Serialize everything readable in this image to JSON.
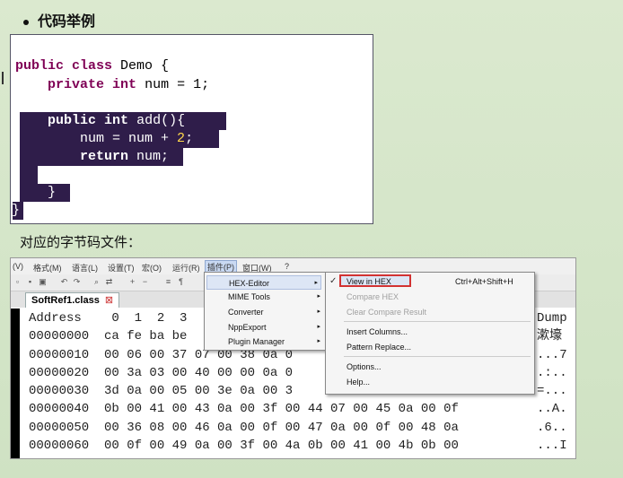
{
  "slide": {
    "bullet": "代码举例",
    "caption": "对应的字节码文件："
  },
  "code": {
    "l1_kw1": "public",
    "l1_kw2": "class",
    "l1_rest": " Demo {",
    "l2_kw1": "private",
    "l2_kw2": "int",
    "l2_rest": " num = ",
    "l2_num": "1",
    "l2_end": ";",
    "l3_kw1": "public",
    "l3_kw2": "int",
    "l3_rest": " add(){",
    "l4_rest": "num = num + ",
    "l4_num": "2",
    "l4_end": ";",
    "l5_kw": "return",
    "l5_rest": " num;",
    "l6": "}",
    "l7": "}"
  },
  "editor": {
    "menubar": [
      "(V)",
      "格式(M)",
      "语言(L)",
      "设置(T)",
      "宏(O)",
      "运行(R)",
      "插件(P)",
      "窗口(W)",
      "?"
    ],
    "tab_label": "SoftRef1.class",
    "tab_close": "⊠",
    "header": "Address    0  1  2  3",
    "dump_header": "Dump",
    "rows": [
      "00000000  ca fe ba be",
      "00000010  00 06 00 37 07 00 38 0a 0",
      "00000020  00 3a 03 00 40 00 00 0a 0",
      "00000030  3d 0a 00 05 00 3e 0a 00 3",
      "00000040  0b 00 41 00 43 0a 00 3f 00 44 07 00 45 0a 00 0f",
      "00000050  00 36 08 00 46 0a 00 0f 00 47 0a 00 0f 00 48 0a",
      "00000060  00 0f 00 49 0a 00 3f 00 4a 0b 00 41 00 4b 0b 00"
    ],
    "dump": [
      "漱壕",
      "...7",
      ".:..",
      "=...",
      "..A.",
      ".6..",
      "...I"
    ]
  },
  "plugin_menu": {
    "items": [
      "HEX-Editor",
      "MIME Tools",
      "Converter",
      "NppExport",
      "Plugin Manager"
    ],
    "arrow": "▸"
  },
  "hex_menu": {
    "check": "✓",
    "view_hex": "View in HEX",
    "view_hex_shortcut": "Ctrl+Alt+Shift+H",
    "compare_hex": "Compare HEX",
    "clear_compare": "Clear Compare Result",
    "insert_columns": "Insert Columns...",
    "pattern_replace": "Pattern Replace...",
    "options": "Options...",
    "help": "Help..."
  }
}
